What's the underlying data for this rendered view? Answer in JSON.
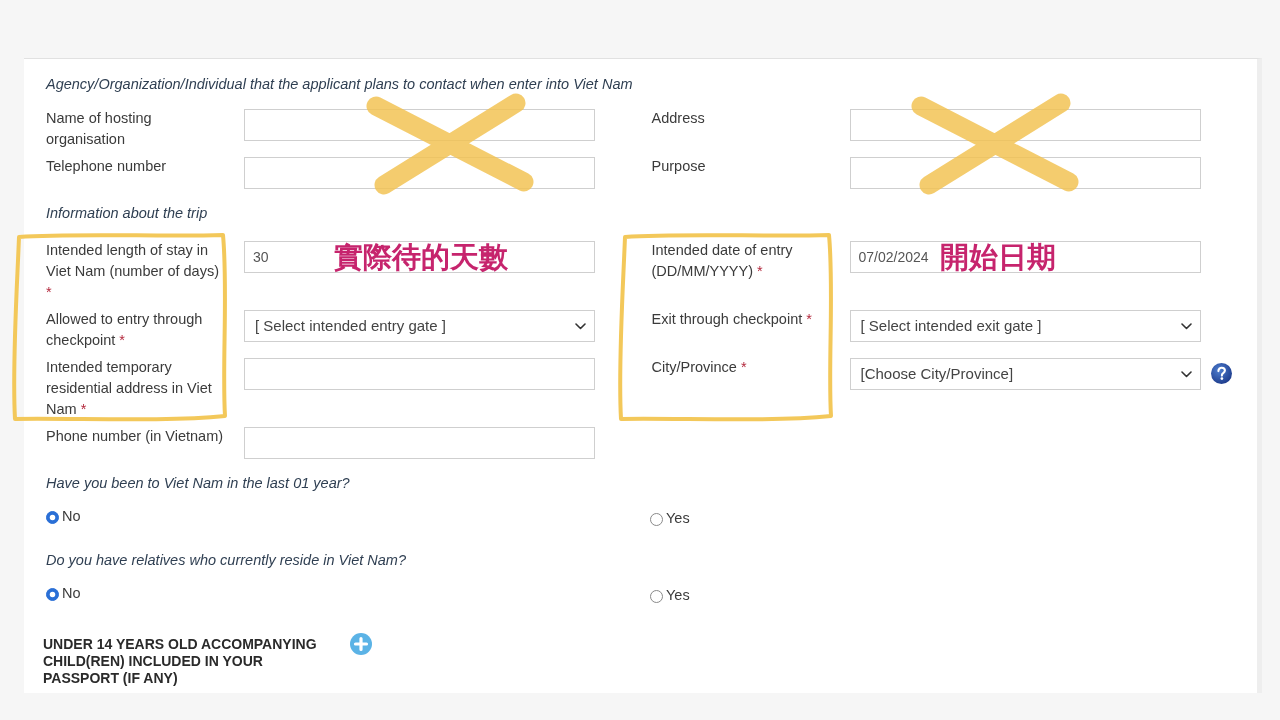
{
  "contact": {
    "heading": "Agency/Organization/Individual that the applicant plans to contact when enter into Viet Nam",
    "rows": [
      {
        "cells": [
          {
            "kind": "text",
            "label": "Name of hosting organisation",
            "crossed_out": true
          },
          {
            "kind": "text",
            "label": "Address",
            "crossed_out": true
          }
        ]
      },
      {
        "cells": [
          {
            "kind": "text",
            "label": "Telephone number",
            "crossed_out": true
          },
          {
            "kind": "text",
            "label": "Purpose",
            "crossed_out": true
          }
        ]
      }
    ]
  },
  "trip": {
    "heading": "Information about the trip",
    "rows": [
      {
        "cells": [
          {
            "kind": "text",
            "label": "Intended length of stay in Viet Nam (number of days)",
            "required_mark": "*",
            "value": "30",
            "note": "實際待的天數",
            "circled": true
          },
          {
            "kind": "text",
            "label": "Intended date of entry (DD/MM/YYYY)",
            "required_mark": "*",
            "value": "07/02/2024",
            "note": "開始日期",
            "circled": true
          }
        ]
      },
      {
        "cells": [
          {
            "kind": "select",
            "label": "Allowed to entry through checkpoint",
            "required_mark": "*",
            "value": "[ Select intended entry gate ]",
            "circled": true
          },
          {
            "kind": "select",
            "label": "Exit through checkpoint",
            "required_mark": "*",
            "value": "[ Select intended exit gate ]",
            "circled": true
          }
        ]
      },
      {
        "cells": [
          {
            "kind": "text",
            "label": "Intended temporary residential address in Viet Nam",
            "required_mark": "*",
            "circled": true
          },
          {
            "kind": "select",
            "label": "City/Province",
            "required_mark": "*",
            "value": "[Choose City/Province]",
            "help": true,
            "circled": true
          }
        ]
      },
      {
        "cells": [
          {
            "kind": "text",
            "label": "Phone number (in Vietnam)",
            "circled": false
          }
        ]
      }
    ]
  },
  "questions": [
    {
      "text": "Have you been to Viet Nam in the last 01 year?",
      "options": [
        {
          "label": "No",
          "selected": true
        },
        {
          "label": "Yes",
          "selected": false
        }
      ]
    },
    {
      "text": "Do you have relatives who currently reside in Viet Nam?",
      "options": [
        {
          "label": "No",
          "selected": true
        },
        {
          "label": "Yes",
          "selected": false
        }
      ]
    }
  ],
  "children_section": {
    "heading": "UNDER 14 YEARS OLD ACCOMPANYING CHILD(REN) INCLUDED IN YOUR PASSPORT (IF ANY)"
  }
}
